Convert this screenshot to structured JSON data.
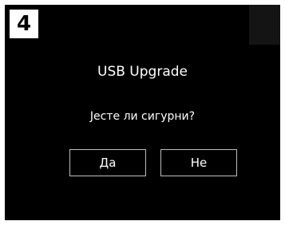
{
  "step_number": "4",
  "dialog": {
    "title": "USB Upgrade",
    "message": "Јесте ли сигурни?",
    "buttons": {
      "yes_label": "Да",
      "no_label": "Не"
    }
  },
  "colors": {
    "screen_background": "#000000",
    "text": "#ffffff",
    "button_border": "#bdbdbd"
  }
}
